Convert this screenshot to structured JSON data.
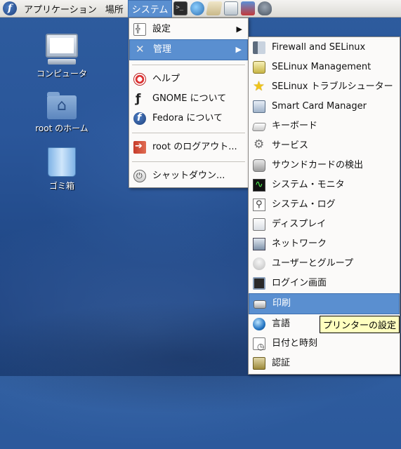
{
  "panel": {
    "menus": [
      "アプリケーション",
      "場所",
      "システム"
    ],
    "launchers": [
      "terminal-icon",
      "web-browser-icon",
      "mail-icon",
      "text-editor-icon",
      "presentation-icon",
      "calculator-icon"
    ]
  },
  "desktop": {
    "icons": [
      {
        "label": "コンピュータ",
        "icon": "computer-icon"
      },
      {
        "label": "root のホーム",
        "icon": "home-folder-icon"
      },
      {
        "label": "ゴミ箱",
        "icon": "trash-icon"
      }
    ]
  },
  "system_menu": {
    "items": [
      {
        "label": "設定",
        "icon": "preferences-icon",
        "submenu": true
      },
      {
        "label": "管理",
        "icon": "administration-icon",
        "submenu": true,
        "highlighted": true
      },
      {
        "label": "ヘルプ",
        "icon": "help-icon"
      },
      {
        "label": "GNOME について",
        "icon": "gnome-icon"
      },
      {
        "label": "Fedora について",
        "icon": "fedora-icon"
      },
      {
        "label": "root のログアウト...",
        "icon": "logout-icon"
      },
      {
        "label": "シャットダウン...",
        "icon": "shutdown-icon"
      }
    ]
  },
  "admin_submenu": {
    "items": [
      {
        "label": "Firewall and SELinux",
        "icon": "firewall-icon"
      },
      {
        "label": "SELinux Management",
        "icon": "selinux-icon"
      },
      {
        "label": "SELinux トラブルシューター",
        "icon": "star-icon"
      },
      {
        "label": "Smart Card Manager",
        "icon": "smartcard-icon"
      },
      {
        "label": "キーボード",
        "icon": "keyboard-icon"
      },
      {
        "label": "サービス",
        "icon": "services-icon"
      },
      {
        "label": "サウンドカードの検出",
        "icon": "soundcard-icon"
      },
      {
        "label": "システム・モニタ",
        "icon": "system-monitor-icon"
      },
      {
        "label": "システム・ログ",
        "icon": "system-log-icon"
      },
      {
        "label": "ディスプレイ",
        "icon": "display-icon"
      },
      {
        "label": "ネットワーク",
        "icon": "network-icon"
      },
      {
        "label": "ユーザーとグループ",
        "icon": "users-icon"
      },
      {
        "label": "ログイン画面",
        "icon": "login-screen-icon"
      },
      {
        "label": "印刷",
        "icon": "printer-icon",
        "highlighted": true
      },
      {
        "label": "言語",
        "icon": "language-icon"
      },
      {
        "label": "日付と時刻",
        "icon": "date-time-icon"
      },
      {
        "label": "認証",
        "icon": "authentication-icon"
      }
    ]
  },
  "tooltip": {
    "text": "プリンターの設定"
  },
  "colors": {
    "highlight": "#5a8fd0",
    "menu_bg": "#fbfaf9",
    "tooltip_bg": "#ffffbf",
    "desktop": "#2a569a"
  }
}
